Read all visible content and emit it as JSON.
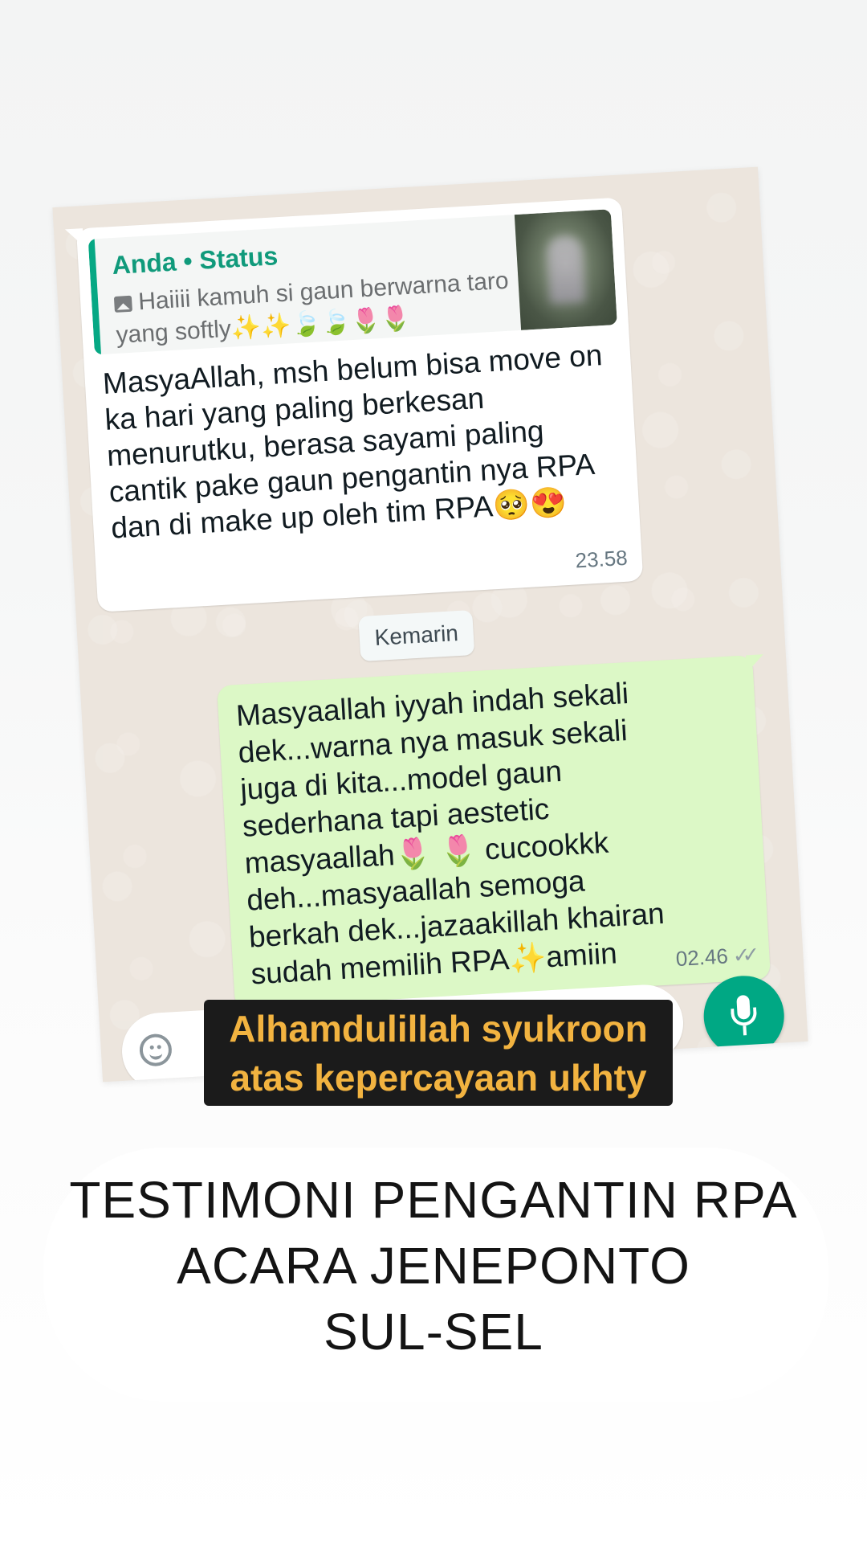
{
  "incoming_message": {
    "quote_author": "Anda • Status",
    "quote_text": "Haiiii kamuh si gaun berwarna taro yang softly✨✨🍃🍃🌷🌷",
    "text": "MasyaAllah, msh belum bisa move on ka hari yang paling berkesan menurutku, berasa sayami paling cantik pake gaun pengantin nya RPA dan di make up oleh tim RPA🥺😍",
    "time": "23.58"
  },
  "date_divider": "Kemarin",
  "outgoing_message": {
    "text": "Masyaallah iyyah indah sekali dek...warna nya masuk sekali juga di kita...model gaun sederhana tapi aestetic masyaallah🌷 🌷 cucookkk deh...masyaallah semoga berkah dek...jazaakillah khairan sudah memilih RPA✨amiin",
    "time": "02.46",
    "read_receipt": "✓✓"
  },
  "caption": {
    "line1": "Alhamdulillah syukroon",
    "line2": "atas kepercayaan ukhty"
  },
  "title": {
    "line1": "TESTIMONI PENGANTIN RPA",
    "line2": "ACARA JENEPONTO",
    "line3": "SUL-SEL"
  },
  "colors": {
    "accent": "#00a884",
    "incoming_bubble": "#ffffff",
    "outgoing_bubble": "#dcf8c6",
    "caption_text": "#f2b340",
    "caption_bg": "#1b1b1b"
  },
  "icons": [
    "photo-icon",
    "emoji-icon",
    "mic-icon",
    "double-check-icon"
  ]
}
